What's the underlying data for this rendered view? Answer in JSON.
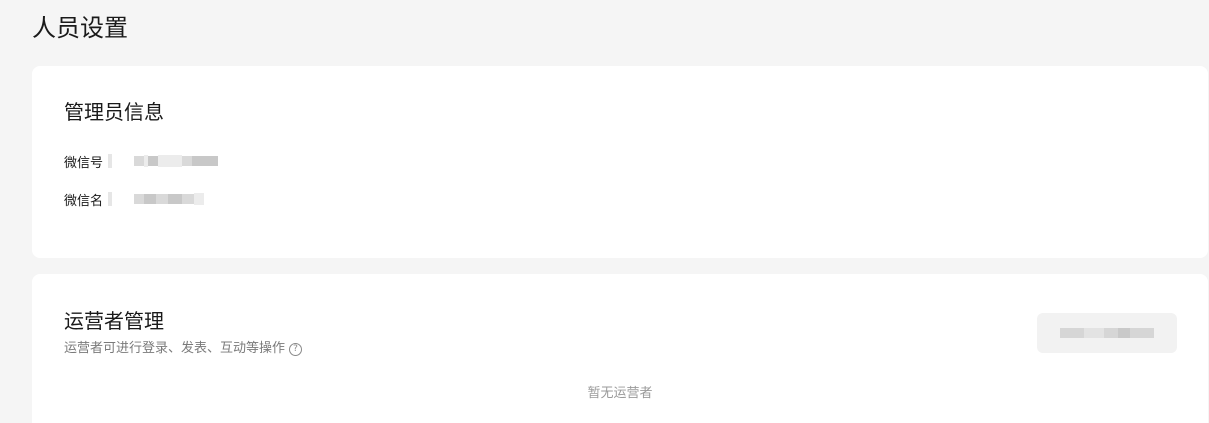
{
  "page": {
    "title": "人员设置"
  },
  "admin_info": {
    "title": "管理员信息",
    "rows": [
      {
        "label": "微信号",
        "value": ""
      },
      {
        "label": "微信名",
        "value": ""
      }
    ]
  },
  "operator": {
    "title": "运营者管理",
    "subtitle": "运营者可进行登录、发表、互动等操作",
    "help_icon": "question-circle-icon",
    "empty_text": "暂无运营者",
    "action_button_label": ""
  },
  "colors": {
    "background": "#f5f5f5",
    "card": "#ffffff",
    "text": "#1a1a1a",
    "subtext": "#7a7a7a",
    "muted": "#9a9a9a"
  }
}
